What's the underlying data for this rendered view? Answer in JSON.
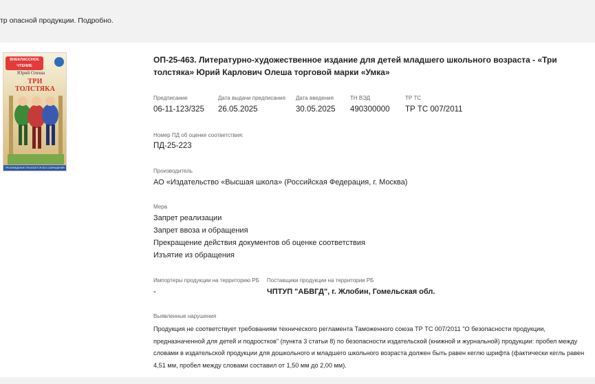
{
  "notice": {
    "text": "тр опасной продукции. Подробно."
  },
  "product": {
    "cover": {
      "series": "ВНЕКЛАССНОЕ ЧТЕНИЕ",
      "author": "Юрий Олеша",
      "title": "ТРИ ТОЛСТЯКА",
      "footer": "ПРОИЗВЕДЕНИЕ ПЕЧАТАЕТСЯ БЕЗ СОКРАЩЕНИЙ"
    },
    "title": "ОП-25-463. Литературно-художественное издание для детей младшего школьного возраста - «Три толстяка» Юрий Карлович Олеша торговой марки «Умка»",
    "fields": [
      {
        "label": "Предписание",
        "value": "06-11-123/325"
      },
      {
        "label": "Дата выдачи предписания",
        "value": "26.05.2025"
      },
      {
        "label": "Дата введения",
        "value": "30.05.2025"
      },
      {
        "label": "ТН ВЭД",
        "value": "490300000"
      },
      {
        "label": "ТР ТС",
        "value": "ТР ТС 007/2011"
      }
    ],
    "pd": {
      "label": "Номер ПД об оценке соответствия:",
      "value": "ПД-25-223"
    },
    "manufacturer": {
      "label": "Производитель",
      "value": "АО «Издательство «Высшая школа» (Российская Федерация, г. Москва)"
    },
    "measures": {
      "label": "Мера",
      "items": [
        "Запрет реализации",
        "Запрет ввоза и обращения",
        "Прекращение действия документов об оценке соответствия",
        "Изъятие из обращения"
      ]
    },
    "importers": {
      "label": "Импортеры продукции на территорию РБ",
      "value": "-"
    },
    "suppliers": {
      "label": "Поставщики продукции на территории РБ",
      "value": "ЧПТУП \"АБВГД\", г. Жлобин, Гомельская обл."
    },
    "violations": {
      "label": "Выявленные нарушения",
      "text": "Продукция не соответствует требованиям технического регламента Таможенного союза ТР ТС 007/2011 \"О безопасности продукции, предназначенной для детей и подростков\" (пункта 3 статьи 8) по безопасности издательской (книжной и журнальной) продукции: пробел между словами в издательской продукции для дошкольного и младшего школьного возраста должен быть равен кеглю шрифта (фактически кегль равен 4,51 мм, пробел между словами составил от 1,50 мм до 2,00 мм)."
    }
  }
}
